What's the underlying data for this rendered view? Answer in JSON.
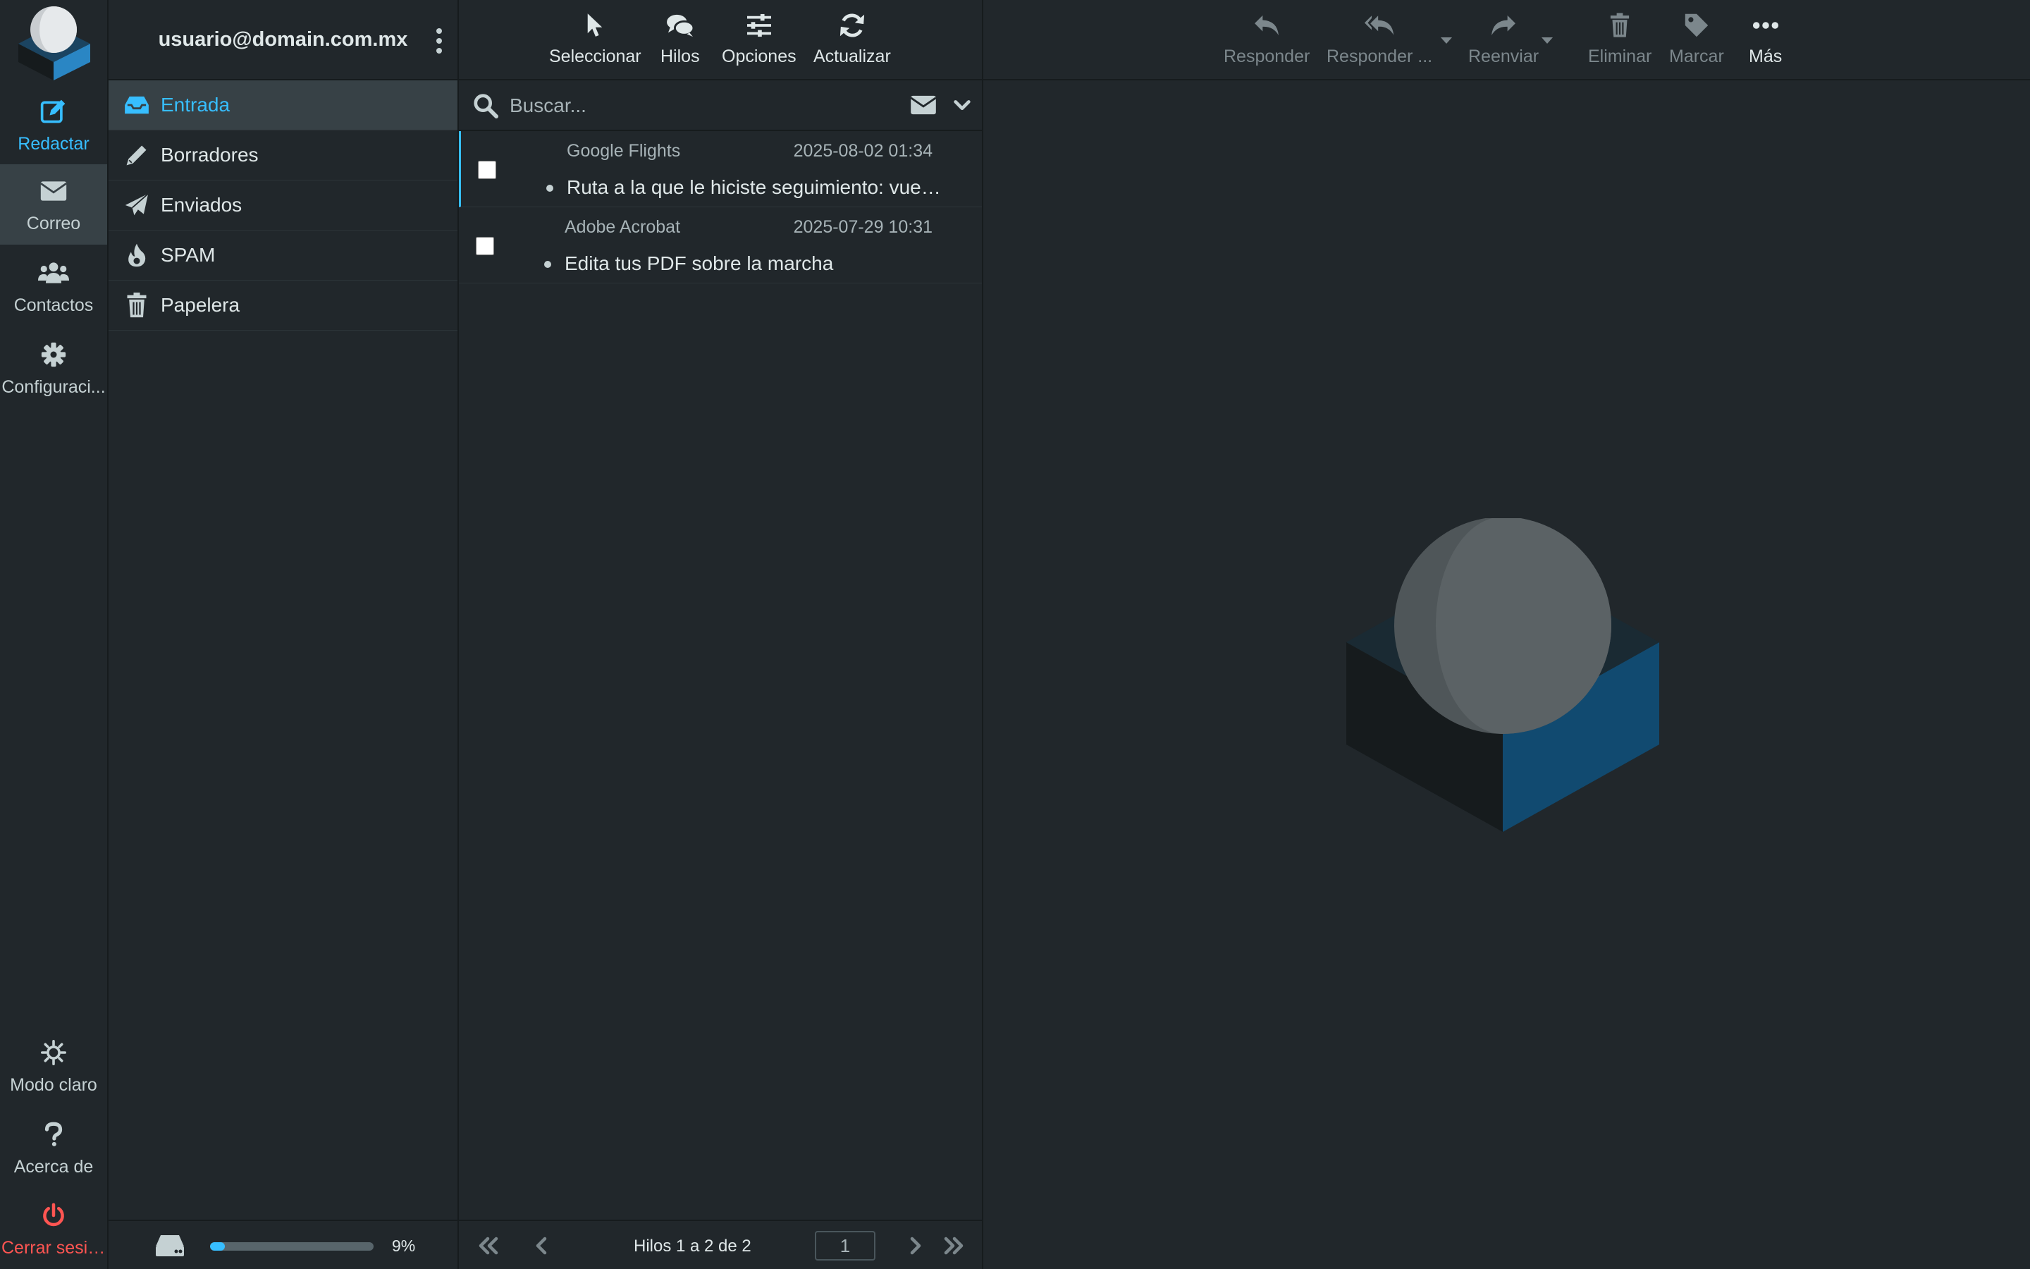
{
  "taskbar": {
    "compose": "Redactar",
    "mail": "Correo",
    "contacts": "Contactos",
    "settings": "Configuraci...",
    "theme": "Modo claro",
    "about": "Acerca de",
    "logout": "Cerrar sesión"
  },
  "account": {
    "email": "usuario@domain.com.mx"
  },
  "folders": [
    {
      "name": "Entrada",
      "icon": "inbox-icon",
      "selected": true
    },
    {
      "name": "Borradores",
      "icon": "pencil-icon"
    },
    {
      "name": "Enviados",
      "icon": "paper-plane-icon"
    },
    {
      "name": "SPAM",
      "icon": "fire-icon"
    },
    {
      "name": "Papelera",
      "icon": "trash-icon"
    }
  ],
  "quota": {
    "percent_label": "9%",
    "fraction": 0.09
  },
  "list_toolbar": {
    "select": "Seleccionar",
    "threads": "Hilos",
    "options": "Opciones",
    "refresh": "Actualizar"
  },
  "search": {
    "placeholder": "Buscar..."
  },
  "messages": [
    {
      "from": "Google Flights",
      "date": "2025-08-02 01:34",
      "subject": "Ruta a la que le hiciste seguimiento: vuelos más baratos"
    },
    {
      "from": "Adobe Acrobat",
      "date": "2025-07-29 10:31",
      "subject": "Edita tus PDF sobre la marcha"
    }
  ],
  "pager": {
    "count_label": "Hilos 1 a 2 de 2",
    "page": "1"
  },
  "preview_toolbar": {
    "reply": "Responder",
    "reply_all": "Responder ...",
    "forward": "Reenviar",
    "delete": "Eliminar",
    "mark": "Marcar",
    "more": "Más"
  },
  "colors": {
    "accent": "#37beff",
    "danger": "#ff5552",
    "background": "#21272b",
    "selected": "#374146"
  }
}
